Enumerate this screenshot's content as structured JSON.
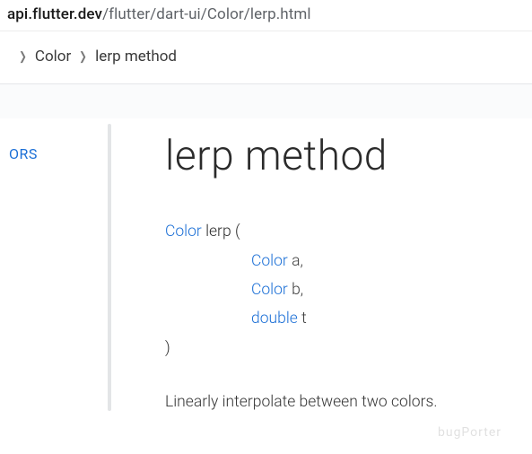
{
  "url": {
    "host": "api.flutter.dev",
    "path": "/flutter/dart-ui/Color/lerp.html"
  },
  "breadcrumb": {
    "items": [
      "Color",
      "lerp method"
    ]
  },
  "sidebar": {
    "partial_link": "ORS"
  },
  "page": {
    "title": "lerp method"
  },
  "signature": {
    "return_type": "Color",
    "method_name": "lerp",
    "open": "(",
    "params": [
      {
        "type": "Color",
        "name": "a",
        "trail": ","
      },
      {
        "type": "Color",
        "name": "b",
        "trail": ","
      },
      {
        "type": "double",
        "name": "t",
        "trail": ""
      }
    ],
    "close": ")"
  },
  "description": "Linearly interpolate between two colors.",
  "watermark": "bugPorter"
}
